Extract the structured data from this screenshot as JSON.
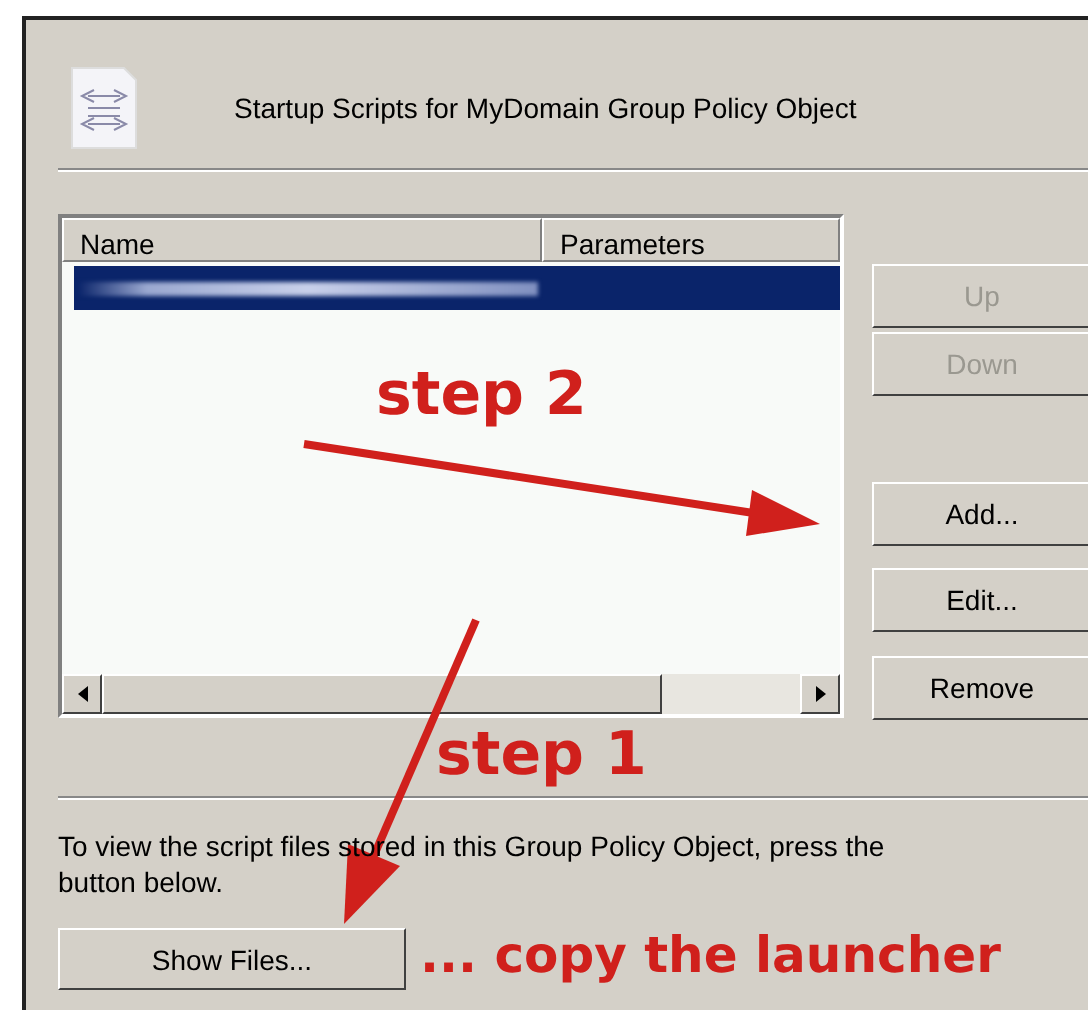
{
  "header": {
    "title": "Startup Scripts for MyDomain Group Policy Object"
  },
  "list": {
    "columns": [
      "Name",
      "Parameters"
    ],
    "rows": [
      {
        "selected": true
      }
    ]
  },
  "buttons": [
    {
      "label": "Up",
      "disabled": true
    },
    {
      "label": "Down",
      "disabled": true
    },
    {
      "label": "Add...",
      "disabled": false
    },
    {
      "label": "Edit...",
      "disabled": false
    },
    {
      "label": "Remove",
      "disabled": false
    }
  ],
  "description": "To view the script files stored in this Group Policy Object, press the button below.",
  "show_files_button": "Show Files...",
  "annotations": [
    {
      "text": "step 2"
    },
    {
      "text": "step 1"
    },
    {
      "text": "... copy the launcher"
    }
  ]
}
